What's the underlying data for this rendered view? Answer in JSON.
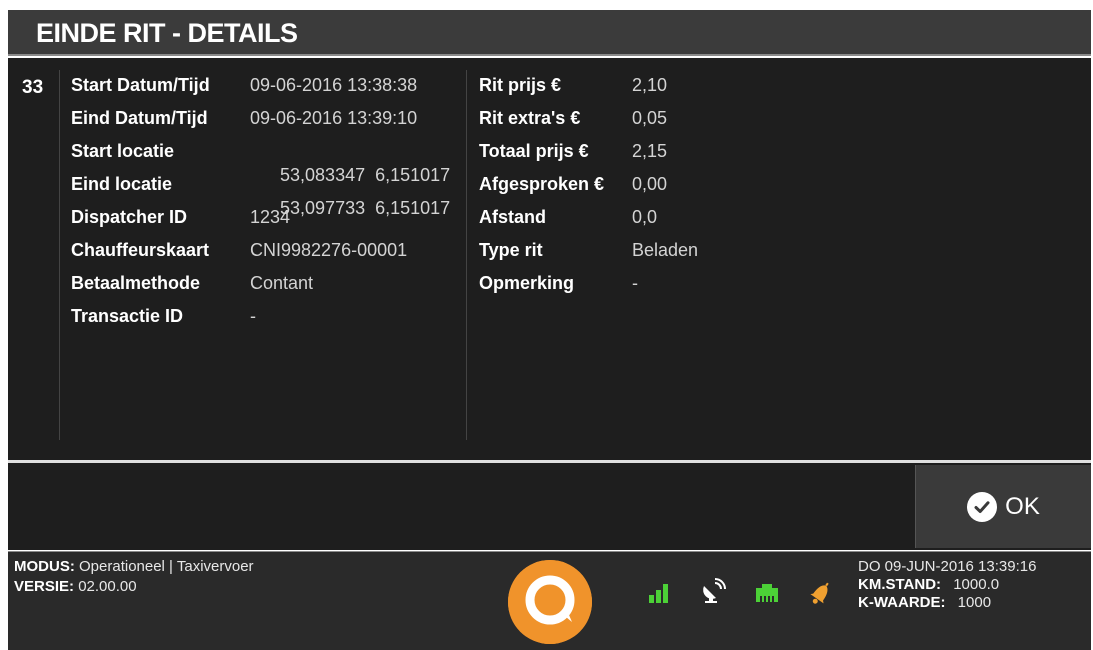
{
  "header": {
    "title": "EINDE RIT - DETAILS"
  },
  "ride": {
    "number": "33",
    "left": [
      {
        "label": "Start Datum/Tijd",
        "value": "09-06-2016 13:38:38"
      },
      {
        "label": "Eind Datum/Tijd",
        "value": "09-06-2016 13:39:10"
      },
      {
        "label": "Start locatie",
        "value": "53,083347  6,151017"
      },
      {
        "label": "Eind locatie",
        "value": "53,097733  6,151017"
      },
      {
        "label": "Dispatcher ID",
        "value": "1234"
      },
      {
        "label": "Chauffeurskaart",
        "value": "CNI9982276-00001"
      },
      {
        "label": "Betaalmethode",
        "value": "Contant"
      },
      {
        "label": "Transactie ID",
        "value": "-"
      }
    ],
    "right": [
      {
        "label": "Rit prijs €",
        "value": "2,10"
      },
      {
        "label": "Rit extra's €",
        "value": "0,05"
      },
      {
        "label": "Totaal prijs €",
        "value": "2,15"
      },
      {
        "label": "Afgesproken €",
        "value": "0,00"
      },
      {
        "label": "Afstand",
        "value": "0,0"
      },
      {
        "label": "Type rit",
        "value": "Beladen"
      },
      {
        "label": "Opmerking",
        "value": "-"
      }
    ]
  },
  "actions": {
    "ok_label": "OK"
  },
  "status": {
    "modus_label": "MODUS:",
    "modus_value": "Operationeel | Taxivervoer",
    "versie_label": "VERSIE:",
    "versie_value": "02.00.00",
    "datetime": "DO 09-JUN-2016 13:39:16",
    "km_label": "KM.STAND:",
    "km_value": "1000.0",
    "k_label": "K-WAARDE:",
    "k_value": "1000",
    "icons": [
      "signal-strength-icon",
      "gps-satellite-icon",
      "network-port-icon",
      "notification-bell-icon"
    ]
  },
  "colors": {
    "logo": "#f0932b",
    "status_ok": "#4cd137",
    "bell": "#f0a030"
  }
}
